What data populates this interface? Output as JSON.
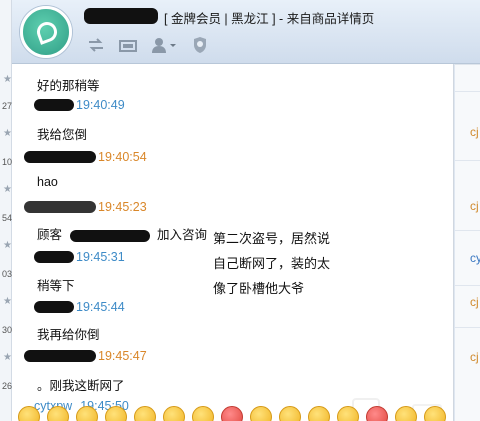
{
  "header": {
    "title_suffix": "[ 金牌会员 | 黑龙江 ] - 来自商品详情页",
    "toolbar_icons": [
      "transfer-icon",
      "folder-icon",
      "user-dropdown-icon",
      "shield-icon"
    ]
  },
  "left_strip": {
    "numbers": [
      "27",
      "10",
      "54",
      "03",
      "30",
      "26"
    ]
  },
  "messages": [
    {
      "text": "好的那稍等"
    },
    {
      "time": "19:40:49",
      "time_color": "blue"
    },
    {
      "text": "我给您倒"
    },
    {
      "time": "19:40:54",
      "time_color": "orange"
    },
    {
      "text": "hao"
    },
    {
      "time": "19:45:23",
      "time_color": "orange"
    },
    {
      "text_prefix": "顾客",
      "text_suffix": "加入咨询"
    },
    {
      "time": "19:45:31",
      "time_color": "blue"
    },
    {
      "text": "稍等下"
    },
    {
      "time": "19:45:44",
      "time_color": "blue"
    },
    {
      "text": "我再给你倒"
    },
    {
      "time": "19:45:47",
      "time_color": "orange"
    },
    {
      "text": "。刚我这断网了"
    },
    {
      "sender": "cytxpw",
      "time": "19:45:50",
      "time_color": "blue"
    }
  ],
  "annotation": {
    "lines": [
      "第二次盗号，居然说",
      "自己断网了，装的太",
      "像了卧槽他大爷"
    ]
  },
  "right_column": {
    "labels": [
      "cj",
      "cj",
      "cy",
      "cj",
      "cj"
    ]
  },
  "colors": {
    "time_blue": "#3e8bc7",
    "time_orange": "#d9872a",
    "header_bg": "#dfe8f3"
  }
}
